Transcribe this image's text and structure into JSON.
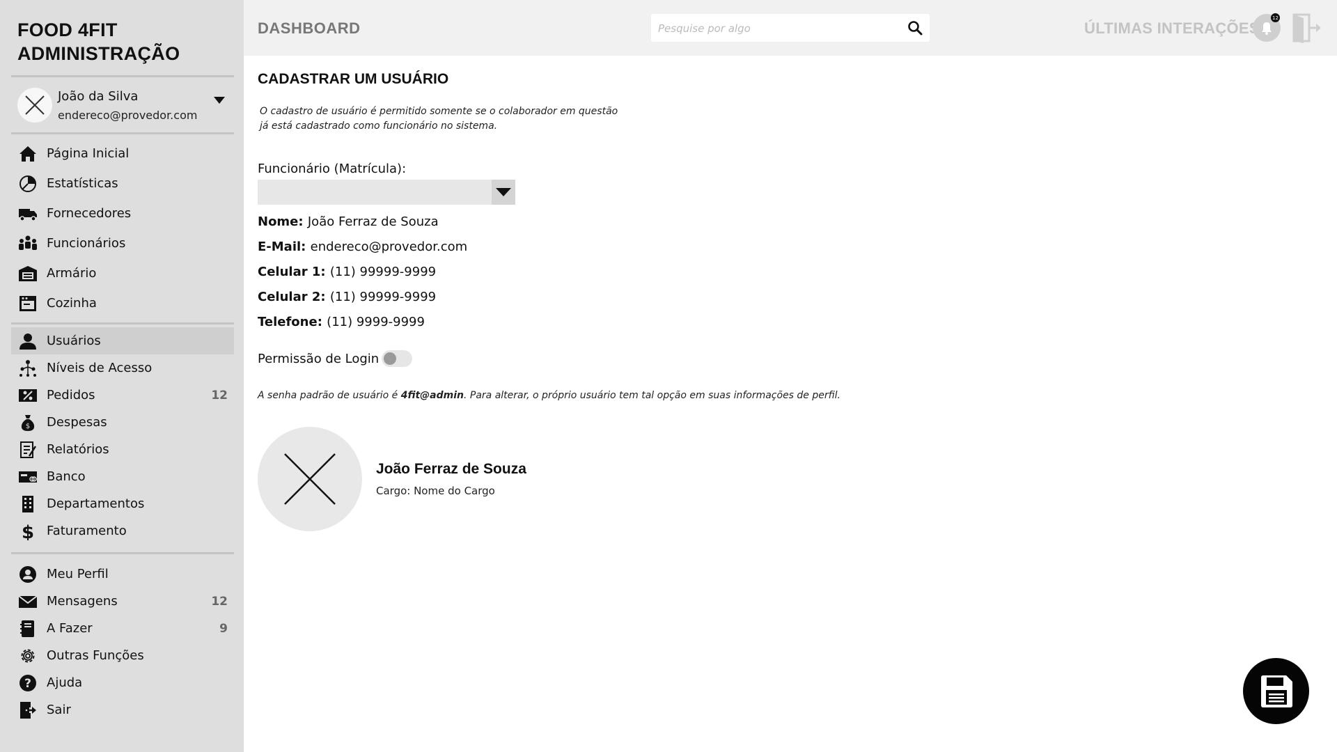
{
  "brand": {
    "line1": "FOOD 4FIT",
    "line2": "ADMINISTRAÇÃO"
  },
  "user": {
    "name": "João da Silva",
    "email": "endereco@provedor.com"
  },
  "nav_main": [
    {
      "label": "Página Inicial",
      "icon": "home-icon"
    },
    {
      "label": "Estatísticas",
      "icon": "pie-chart-icon"
    },
    {
      "label": "Fornecedores",
      "icon": "truck-icon"
    },
    {
      "label": "Funcionários",
      "icon": "people-icon"
    },
    {
      "label": "Armário",
      "icon": "cabinet-icon"
    },
    {
      "label": "Cozinha",
      "icon": "oven-icon"
    }
  ],
  "nav_admin": [
    {
      "label": "Usuários",
      "icon": "user-icon",
      "active": true
    },
    {
      "label": "Níveis de Acesso",
      "icon": "hierarchy-icon"
    },
    {
      "label": "Pedidos",
      "icon": "percent-tag-icon",
      "badge": "12"
    },
    {
      "label": "Despesas",
      "icon": "money-bag-icon"
    },
    {
      "label": "Relatórios",
      "icon": "report-icon"
    },
    {
      "label": "Banco",
      "icon": "bank-card-icon"
    },
    {
      "label": "Departamentos",
      "icon": "building-icon"
    },
    {
      "label": "Faturamento",
      "icon": "dollar-icon"
    }
  ],
  "nav_personal": [
    {
      "label": "Meu Perfil",
      "icon": "profile-icon"
    },
    {
      "label": "Mensagens",
      "icon": "envelope-icon",
      "badge": "12"
    },
    {
      "label": "A Fazer",
      "icon": "notebook-icon",
      "badge": "9"
    },
    {
      "label": "Outras Funções",
      "icon": "gear-icon"
    },
    {
      "label": "Ajuda",
      "icon": "help-icon"
    },
    {
      "label": "Sair",
      "icon": "exit-icon"
    }
  ],
  "header": {
    "title": "DASHBOARD",
    "search_placeholder": "Pesquise por algo",
    "recent_label": "ÚLTIMAS INTERAÇÕES",
    "notification_count": "12"
  },
  "form": {
    "title": "CADASTRAR UM USUÁRIO",
    "note": "O cadastro de usuário é permitido somente se o colaborador em questão já está cadastrado como funcionário no sistema.",
    "employee_label": "Funcionário (Matrícula):",
    "employee_value": "",
    "details": [
      {
        "key": "Nome",
        "value": "João Ferraz de Souza"
      },
      {
        "key": "E-Mail",
        "value": "endereco@provedor.com"
      },
      {
        "key": "Celular 1",
        "value": "(11) 99999-9999"
      },
      {
        "key": "Celular 2",
        "value": "(11) 99999-9999"
      },
      {
        "key": "Telefone",
        "value": "(11) 9999-9999"
      }
    ],
    "login_permission_label": "Permissão de Login",
    "login_permission_enabled": false,
    "password_note_prefix": "A senha padrão de usuário é ",
    "password_default": "4fit@admin",
    "password_note_suffix": ". Para alterar, o próprio usuário tem tal opção em suas informações de perfil."
  },
  "profile": {
    "name": "João Ferraz de Souza",
    "role": "Cargo: Nome do Cargo"
  },
  "colors": {
    "sidebar_bg": "#dedede",
    "topbar_bg": "#f1f1f1",
    "accent": "#050505"
  }
}
